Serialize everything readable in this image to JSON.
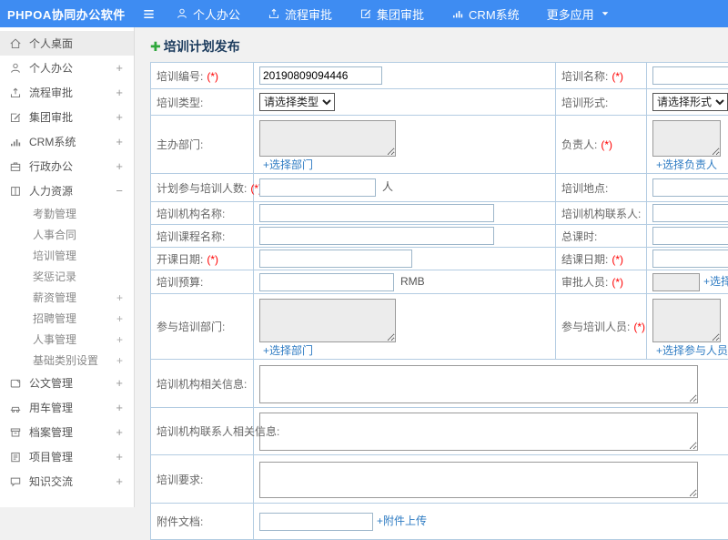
{
  "colors": {
    "accent_blue": "#3e8cf2",
    "link_blue": "#2f7cc3",
    "required_red": "#ff0000",
    "title_navy": "#1a3a5c",
    "plus_green": "#2fa73c"
  },
  "header": {
    "app_title": "PHPOA协同办公软件",
    "menu_icon": "hamburger-icon",
    "nav": [
      {
        "label": "个人办公",
        "icon": "user-icon"
      },
      {
        "label": "流程审批",
        "icon": "upload-icon"
      },
      {
        "label": "集团审批",
        "icon": "edit-icon"
      },
      {
        "label": "CRM系统",
        "icon": "chart-icon"
      },
      {
        "label": "更多应用",
        "icon": "caret-down-icon",
        "caret_after": true
      }
    ]
  },
  "sidebar": {
    "items": [
      {
        "name": "personal-desktop",
        "label": "个人桌面",
        "icon": "home-icon",
        "active": true
      },
      {
        "name": "personal-office",
        "label": "个人办公",
        "icon": "user-icon",
        "expand": "+"
      },
      {
        "name": "workflow-approval",
        "label": "流程审批",
        "icon": "upload-icon",
        "expand": "+"
      },
      {
        "name": "group-approval",
        "label": "集团审批",
        "icon": "edit-icon",
        "expand": "+"
      },
      {
        "name": "crm-system",
        "label": "CRM系统",
        "icon": "chart-icon",
        "expand": "+"
      },
      {
        "name": "admin-office",
        "label": "行政办公",
        "icon": "briefcase-icon",
        "expand": "+"
      },
      {
        "name": "human-resources",
        "label": "人力资源",
        "icon": "hr-icon",
        "expand": "−",
        "children": [
          {
            "name": "attendance-mgmt",
            "label": "考勤管理"
          },
          {
            "name": "personnel-contract",
            "label": "人事合同"
          },
          {
            "name": "training-mgmt",
            "label": "培训管理"
          },
          {
            "name": "reward-punishment",
            "label": "奖惩记录"
          },
          {
            "name": "salary-mgmt",
            "label": "薪资管理",
            "expand": "+"
          },
          {
            "name": "recruitment-mgmt",
            "label": "招聘管理",
            "expand": "+"
          },
          {
            "name": "personnel-mgmt",
            "label": "人事管理",
            "expand": "+"
          },
          {
            "name": "base-category-settings",
            "label": "基础类别设置",
            "expand": "+"
          }
        ]
      },
      {
        "name": "document-mgmt",
        "label": "公文管理",
        "icon": "doc-icon",
        "expand": "+"
      },
      {
        "name": "vehicle-mgmt",
        "label": "用车管理",
        "icon": "car-icon",
        "expand": "+"
      },
      {
        "name": "archive-mgmt",
        "label": "档案管理",
        "icon": "archive-icon",
        "expand": "+"
      },
      {
        "name": "project-mgmt",
        "label": "项目管理",
        "icon": "project-icon",
        "expand": "+"
      },
      {
        "name": "knowledge-exchange",
        "label": "知识交流",
        "icon": "chat-icon",
        "expand": "+"
      }
    ]
  },
  "form": {
    "title": "培训计划发布",
    "title_icon": "plus-icon",
    "rows": [
      {
        "left": {
          "name": "training-number",
          "label": "培训编号:",
          "required": true,
          "field": {
            "type": "input",
            "value": "20190809094446"
          }
        },
        "right": {
          "name": "training-name",
          "label": "培训名称:",
          "required": true,
          "field": {
            "type": "input",
            "value": ""
          }
        }
      },
      {
        "left": {
          "name": "training-type",
          "label": "培训类型:",
          "field": {
            "type": "select",
            "value": "请选择类型"
          }
        },
        "right": {
          "name": "training-form",
          "label": "培训形式:",
          "field": {
            "type": "select",
            "value": "请选择形式"
          }
        }
      },
      {
        "left": {
          "name": "host-department",
          "label": "主办部门:",
          "field": {
            "type": "textarea",
            "readonly": true,
            "link": "+选择部门"
          }
        },
        "right": {
          "name": "responsible-person",
          "label": "负责人:",
          "required": true,
          "field": {
            "type": "textarea",
            "readonly": true,
            "link": "+选择负责人"
          }
        }
      },
      {
        "left": {
          "name": "planned-participants",
          "label": "计划参与培训人数:",
          "required": true,
          "field": {
            "type": "input",
            "value": "",
            "suffix": "人"
          }
        },
        "right": {
          "name": "training-location",
          "label": "培训地点:",
          "field": {
            "type": "input",
            "value": ""
          }
        }
      },
      {
        "left": {
          "name": "training-org-name",
          "label": "培训机构名称:",
          "field": {
            "type": "input",
            "value": ""
          }
        },
        "right": {
          "name": "training-org-contact",
          "label": "培训机构联系人:",
          "field": {
            "type": "input",
            "value": ""
          }
        }
      },
      {
        "left": {
          "name": "course-name",
          "label": "培训课程名称:",
          "field": {
            "type": "input",
            "value": ""
          }
        },
        "right": {
          "name": "total-hours",
          "label": "总课时:",
          "field": {
            "type": "input",
            "value": ""
          }
        }
      },
      {
        "left": {
          "name": "start-date",
          "label": "开课日期:",
          "required": true,
          "field": {
            "type": "input",
            "value": ""
          }
        },
        "right": {
          "name": "end-date",
          "label": "结课日期:",
          "required": true,
          "field": {
            "type": "input",
            "value": ""
          }
        }
      },
      {
        "left": {
          "name": "training-budget",
          "label": "培训预算:",
          "field": {
            "type": "input",
            "value": "",
            "suffix": "RMB"
          }
        },
        "right": {
          "name": "approvers",
          "label": "审批人员:",
          "required": true,
          "field": {
            "type": "input",
            "value": "",
            "readonly": true,
            "link_inline": "+选择审批人员"
          }
        }
      },
      {
        "left": {
          "name": "participating-departments",
          "label": "参与培训部门:",
          "field": {
            "type": "textarea",
            "readonly": true,
            "link": "+选择部门"
          }
        },
        "right": {
          "name": "participating-personnel",
          "label": "参与培训人员:",
          "required": true,
          "field": {
            "type": "textarea",
            "readonly": true,
            "link": "+选择参与人员"
          }
        }
      },
      {
        "span": {
          "name": "training-org-info",
          "label": "培训机构相关信息:",
          "field": {
            "type": "textarea"
          }
        }
      },
      {
        "span": {
          "name": "training-org-contact-info",
          "label": "培训机构联系人相关信息:",
          "field": {
            "type": "textarea"
          }
        }
      },
      {
        "span": {
          "name": "training-requirements",
          "label": "培训要求:",
          "field": {
            "type": "textarea"
          }
        }
      },
      {
        "span": {
          "name": "attachment",
          "label": "附件文档:",
          "field": {
            "type": "input",
            "value": "",
            "link_inline": "+附件上传"
          }
        }
      }
    ]
  }
}
